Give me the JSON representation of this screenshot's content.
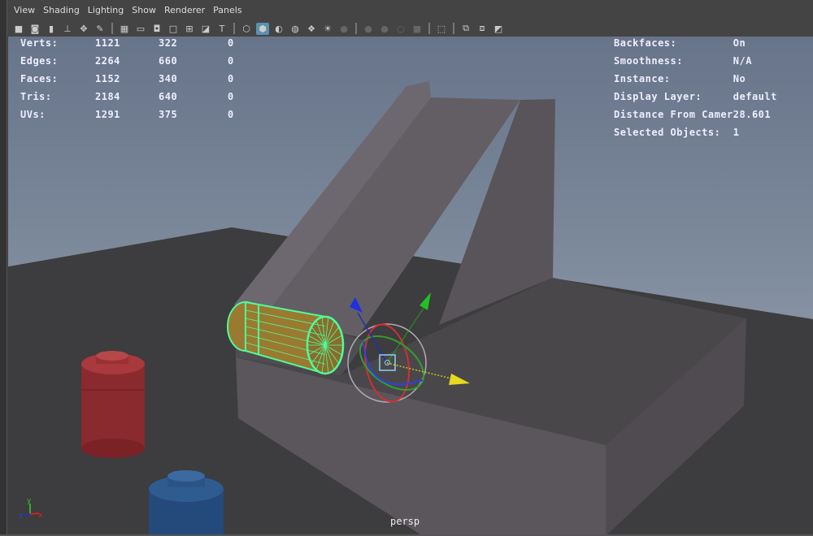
{
  "menu": [
    "View",
    "Shading",
    "Lighting",
    "Show",
    "Renderer",
    "Panels"
  ],
  "toolbar": [
    {
      "icon": "camera-icon",
      "glyph": "■"
    },
    {
      "icon": "camera-attributes-icon",
      "glyph": "◙"
    },
    {
      "icon": "bookmark-icon",
      "glyph": "▮"
    },
    {
      "icon": "image-plane-icon",
      "glyph": "⊥"
    },
    {
      "icon": "2d-pan-zoom-icon",
      "glyph": "✥"
    },
    {
      "icon": "grease-pencil-icon",
      "glyph": "✎"
    },
    {
      "sep": true
    },
    {
      "icon": "grid-icon",
      "glyph": "▦"
    },
    {
      "icon": "film-gate-icon",
      "glyph": "▭"
    },
    {
      "icon": "resolution-gate-icon",
      "glyph": "◘"
    },
    {
      "icon": "gate-mask-icon",
      "glyph": "□"
    },
    {
      "icon": "field-chart-icon",
      "glyph": "⊞"
    },
    {
      "icon": "safe-action-icon",
      "glyph": "◪"
    },
    {
      "icon": "safe-title-icon",
      "glyph": "T"
    },
    {
      "sep": true
    },
    {
      "icon": "wireframe-icon",
      "glyph": "⬡"
    },
    {
      "icon": "smooth-shade-icon",
      "glyph": "⬢",
      "active": true
    },
    {
      "icon": "default-material-icon",
      "glyph": "◐"
    },
    {
      "icon": "textured-icon",
      "glyph": "◍"
    },
    {
      "icon": "wireframe-on-shaded-icon",
      "glyph": "❖"
    },
    {
      "icon": "use-lights-icon",
      "glyph": "☀"
    },
    {
      "icon": "shadows-icon",
      "glyph": "●",
      "dim": true
    },
    {
      "sep": true
    },
    {
      "icon": "ambient-occlusion-icon",
      "glyph": "●",
      "dim": true
    },
    {
      "icon": "motion-blur-icon",
      "glyph": "●",
      "dim": true
    },
    {
      "icon": "anti-aliasing-icon",
      "glyph": "○",
      "dim": true
    },
    {
      "icon": "depth-of-field-icon",
      "glyph": "■",
      "dim": true
    },
    {
      "sep": true
    },
    {
      "icon": "isolate-select-icon",
      "glyph": "⬚"
    },
    {
      "sep": true
    },
    {
      "icon": "xray-icon",
      "glyph": "⧉"
    },
    {
      "icon": "xray-joints-icon",
      "glyph": "⧈"
    },
    {
      "icon": "xray-components-icon",
      "glyph": "◩"
    }
  ],
  "stats": [
    {
      "label": "Verts:",
      "a": "1121",
      "b": "322",
      "c": "0"
    },
    {
      "label": "Edges:",
      "a": "2264",
      "b": "660",
      "c": "0"
    },
    {
      "label": "Faces:",
      "a": "1152",
      "b": "340",
      "c": "0"
    },
    {
      "label": "Tris:",
      "a": "2184",
      "b": "640",
      "c": "0"
    },
    {
      "label": "UVs:",
      "a": "1291",
      "b": "375",
      "c": "0"
    }
  ],
  "info": [
    {
      "label": "Backfaces:",
      "value": "On"
    },
    {
      "label": "Smoothness:",
      "value": "N/A"
    },
    {
      "label": "Instance:",
      "value": "No"
    },
    {
      "label": "Display Layer:",
      "value": "default"
    },
    {
      "label": "Distance From Camer",
      "value": "28.601"
    },
    {
      "label": "Selected Objects:",
      "value": "1"
    }
  ],
  "camera_name": "persp",
  "axis": {
    "x": "x",
    "y": "y",
    "z": "z"
  },
  "colors": {
    "selection": "#4dff9a",
    "x_axis": "#e0d020",
    "y_axis": "#22b022",
    "z_axis": "#2030e0"
  }
}
